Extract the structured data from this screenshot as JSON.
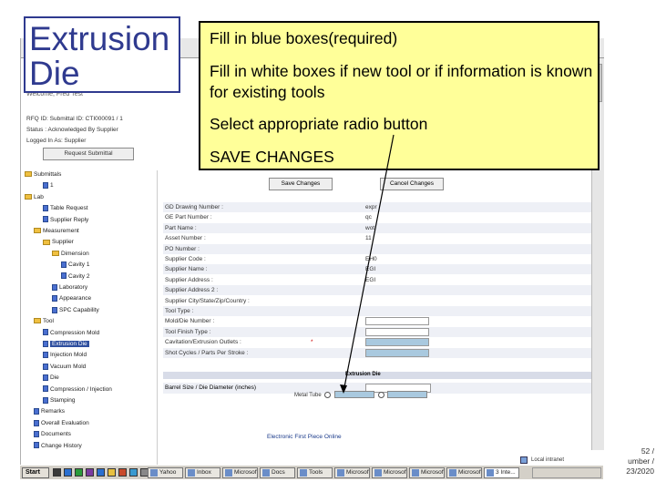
{
  "slide": {
    "title_line1": "Extrusion",
    "title_line2": "Die",
    "instructions": [
      "Fill in blue boxes(required)",
      "Fill in white boxes if new tool or if information is known for existing tools",
      "Select appropriate radio button",
      "SAVE CHANGES"
    ],
    "slide_number": "52 / ",
    "slide_number2": "umber /",
    "slide_date": "23/2020"
  },
  "app": {
    "welcome": "Welcome, Fred Test",
    "rfq_line": "RFQ ID: Submittal ID: CTI000091 / 1",
    "status_line": "Status : Acknowledged By Supplier",
    "login_line": "Logged In As: Supplier",
    "request_button": "Request Submittal",
    "save_button": "Save Changes",
    "cancel_button": "Cancel Changes",
    "section_title": "Extrusion Die",
    "barrel_label": "Barrel Size / Die Diameter (inches)",
    "radio_prefix": "Metal Tube",
    "footer_link": "Electronic First Piece Online",
    "local_label": "Local intranet",
    "tree_items": [
      {
        "label": "Submittals",
        "kind": "folder"
      },
      {
        "label": "1",
        "kind": "doc"
      },
      {
        "label": "Lab",
        "kind": "folder"
      },
      {
        "label": "Table Request",
        "kind": "doc"
      },
      {
        "label": "Supplier Reply",
        "kind": "doc"
      },
      {
        "label": "Measurement",
        "kind": "folder"
      },
      {
        "label": "Supplier",
        "kind": "folder"
      },
      {
        "label": "Dimension",
        "kind": "folder"
      },
      {
        "label": "Cavity 1",
        "kind": "doc"
      },
      {
        "label": "Cavity 2",
        "kind": "doc"
      },
      {
        "label": "Laboratory",
        "kind": "doc"
      },
      {
        "label": "Appearance",
        "kind": "doc"
      },
      {
        "label": "SPC Capability",
        "kind": "doc"
      },
      {
        "label": "Tool",
        "kind": "folder"
      },
      {
        "label": "Compression Mold",
        "kind": "doc"
      },
      {
        "label": "Extrusion Die",
        "kind": "doc",
        "selected": true
      },
      {
        "label": "Injection Mold",
        "kind": "doc"
      },
      {
        "label": "Vacuum Mold",
        "kind": "doc"
      },
      {
        "label": "Die",
        "kind": "doc"
      },
      {
        "label": "Compression / Injection",
        "kind": "doc"
      },
      {
        "label": "Stamping",
        "kind": "doc"
      },
      {
        "label": "Remarks",
        "kind": "doc"
      },
      {
        "label": "Overall Evaluation",
        "kind": "doc"
      },
      {
        "label": "Documents",
        "kind": "doc"
      },
      {
        "label": "Change History",
        "kind": "doc"
      }
    ],
    "form_rows": [
      {
        "label": "GD Drawing Number :",
        "value": "expr",
        "kind": "text"
      },
      {
        "label": "GE Part Number :",
        "value": "qc",
        "kind": "text"
      },
      {
        "label": "Part Name :",
        "value": "wot",
        "kind": "text"
      },
      {
        "label": "Asset Number :",
        "value": "11",
        "kind": "text"
      },
      {
        "label": "PO Number :",
        "value": "",
        "kind": "text"
      },
      {
        "label": "Supplier Code :",
        "value": "EH0",
        "kind": "text"
      },
      {
        "label": "Supplier Name :",
        "value": "EGI",
        "kind": "text"
      },
      {
        "label": "Supplier Address :",
        "value": "EGI",
        "kind": "text"
      },
      {
        "label": "Supplier Address 2 :",
        "value": "",
        "kind": "text"
      },
      {
        "label": "Supplier City/State/Zip/Country :",
        "value": "",
        "kind": "text"
      },
      {
        "label": "Tool Type :",
        "value": "",
        "kind": "text"
      },
      {
        "label": "Mold/Die Number :",
        "value": "",
        "kind": "white"
      },
      {
        "label": "Tool Finish Type :",
        "value": "",
        "kind": "white"
      },
      {
        "label": "Cavitation/Extrusion Outlets :",
        "value": "",
        "kind": "blue",
        "required": "*"
      },
      {
        "label": "Shot Cycles / Parts Per Stroke :",
        "value": "",
        "kind": "blue"
      }
    ]
  },
  "taskbar": {
    "start": "Start",
    "tasks": [
      "Yahoo",
      "Inbox",
      "Microsoft",
      "Docs",
      "Tools",
      "Microsoft",
      "Microsoft",
      "Microsoft",
      "Microsoft",
      "3 Inte..."
    ]
  },
  "colors": {
    "title_blue": "#2f3a8f",
    "callout_yellow": "#ffff99",
    "field_blue": "#a9c9df"
  }
}
